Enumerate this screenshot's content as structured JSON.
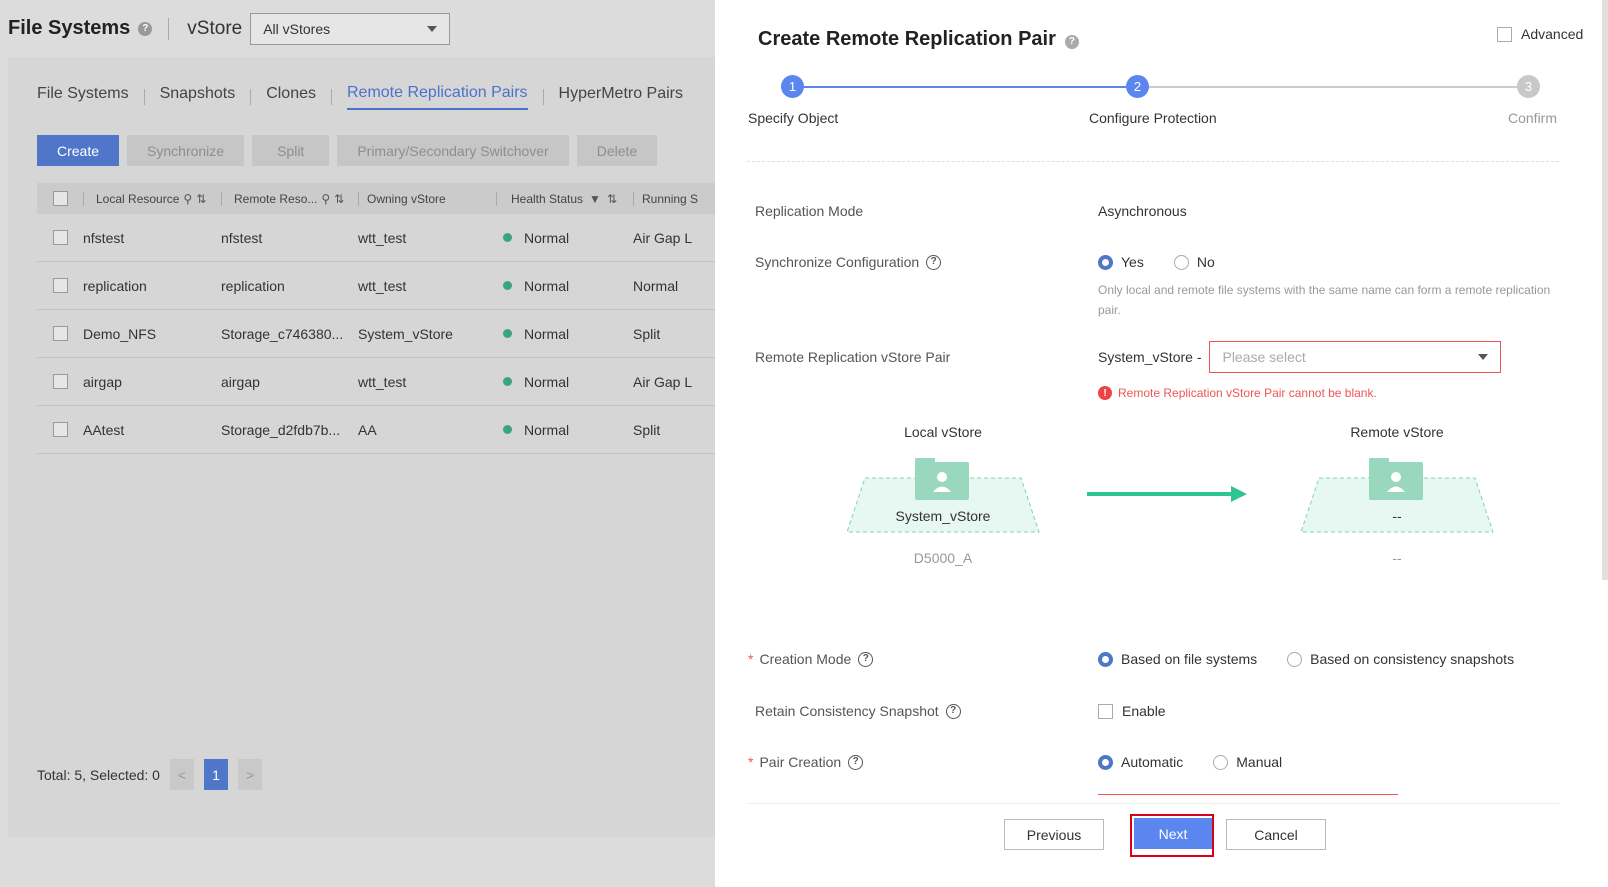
{
  "header": {
    "title": "File Systems",
    "vstore_label": "vStore",
    "vstore_selected": "All vStores"
  },
  "tabs": [
    {
      "label": "File Systems"
    },
    {
      "label": "Snapshots"
    },
    {
      "label": "Clones"
    },
    {
      "label": "Remote Replication Pairs",
      "active": true
    },
    {
      "label": "HyperMetro Pairs"
    }
  ],
  "toolbar": {
    "create": "Create",
    "synchronize": "Synchronize",
    "split": "Split",
    "switchover": "Primary/Secondary Switchover",
    "delete": "Delete"
  },
  "table": {
    "columns": [
      "Local Resource",
      "Remote Reso...",
      "Owning vStore",
      "Health Status",
      "Running S"
    ],
    "rows": [
      {
        "local": "nfstest",
        "remote": "nfstest",
        "vstore": "wtt_test",
        "health": "Normal",
        "running": "Air Gap L"
      },
      {
        "local": "replication",
        "remote": "replication",
        "vstore": "wtt_test",
        "health": "Normal",
        "running": "Normal"
      },
      {
        "local": "Demo_NFS",
        "remote": "Storage_c746380...",
        "vstore": "System_vStore",
        "health": "Normal",
        "running": "Split"
      },
      {
        "local": "airgap",
        "remote": "airgap",
        "vstore": "wtt_test",
        "health": "Normal",
        "running": "Air Gap L"
      },
      {
        "local": "AAtest",
        "remote": "Storage_d2fdb7b...",
        "vstore": "AA",
        "health": "Normal",
        "running": "Split"
      }
    ]
  },
  "pager": {
    "summary": "Total: 5, Selected: 0",
    "prev": "<",
    "current": "1",
    "next": ">"
  },
  "drawer": {
    "title": "Create Remote Replication Pair",
    "advanced": "Advanced",
    "steps": [
      {
        "num": "1",
        "label": "Specify Object",
        "state": "done"
      },
      {
        "num": "2",
        "label": "Configure Protection",
        "state": "current"
      },
      {
        "num": "3",
        "label": "Confirm",
        "state": "pending"
      }
    ],
    "replication_mode": {
      "label": "Replication Mode",
      "value": "Asynchronous"
    },
    "sync_config": {
      "label": "Synchronize Configuration",
      "yes": "Yes",
      "no": "No",
      "selected": "Yes",
      "hint": "Only local and remote file systems with the same name can form a remote replication pair."
    },
    "vstore_pair": {
      "label": "Remote Replication vStore Pair",
      "prefix": "System_vStore -",
      "placeholder": "Please select",
      "error": "Remote Replication vStore Pair cannot be blank."
    },
    "diagram": {
      "local_title": "Local vStore",
      "local_name": "System_vStore",
      "local_device": "D5000_A",
      "remote_title": "Remote vStore",
      "remote_name": "--",
      "remote_device": "--",
      "colors": {
        "fill": "#e7f7f1",
        "stroke": "#7fd3b2",
        "folder": "#9ad7bf",
        "arrow": "#2ec495"
      }
    },
    "creation_mode": {
      "label": "Creation Mode",
      "opt1": "Based on file systems",
      "opt2": "Based on consistency snapshots",
      "selected": "Based on file systems"
    },
    "retain_snapshot": {
      "label": "Retain Consistency Snapshot",
      "option": "Enable",
      "checked": false
    },
    "pair_creation": {
      "label": "Pair Creation",
      "opt1": "Automatic",
      "opt2": "Manual",
      "selected": "Automatic"
    },
    "footer": {
      "previous": "Previous",
      "next": "Next",
      "cancel": "Cancel"
    }
  },
  "colors": {
    "accent": "#4f76c9",
    "error": "#e55555",
    "health_normal": "#3aa57e",
    "next_button": "#5b86f0",
    "highlight_frame": "#d9001b"
  }
}
